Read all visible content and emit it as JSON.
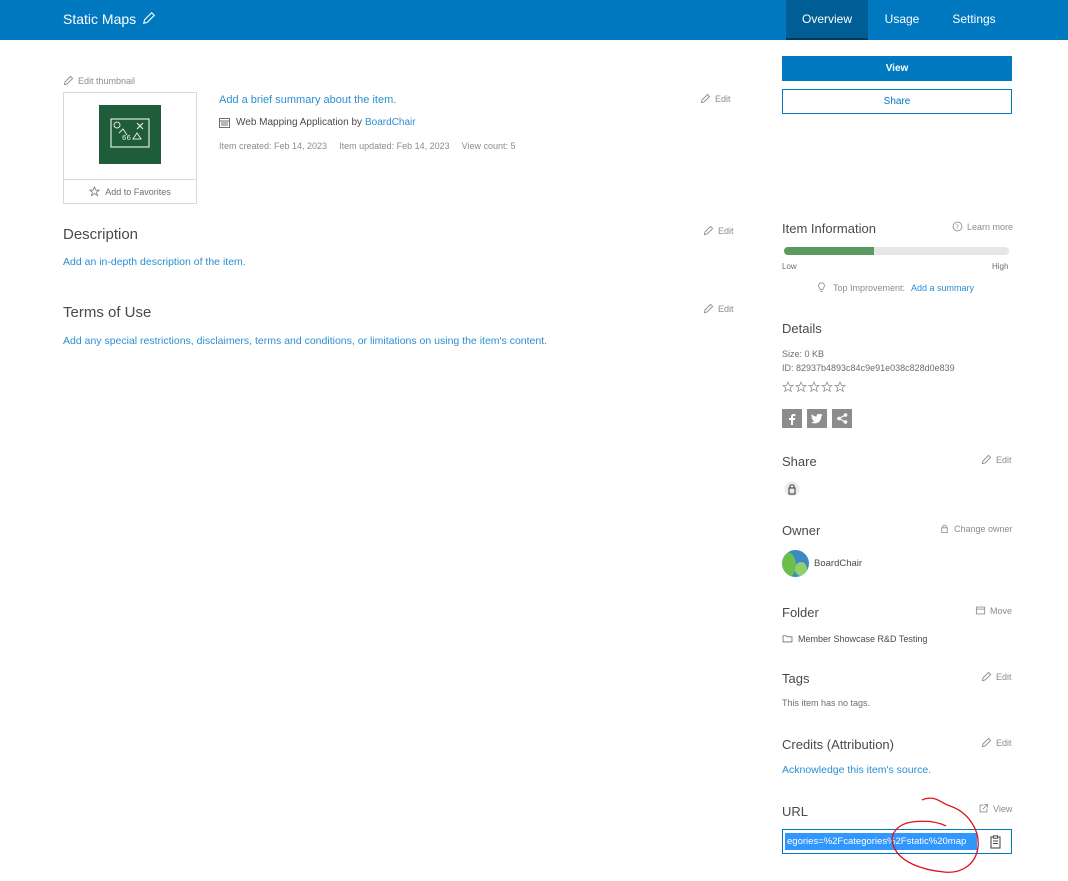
{
  "header": {
    "title": "Static Maps",
    "tabs": [
      {
        "label": "Overview",
        "active": true
      },
      {
        "label": "Usage",
        "active": false
      },
      {
        "label": "Settings",
        "active": false
      }
    ]
  },
  "item": {
    "edit_thumbnail": "Edit thumbnail",
    "add_favorites": "Add to Favorites",
    "summary_link": "Add a brief summary about the item.",
    "edit_label": "Edit",
    "type_prefix": "Web Mapping Application by",
    "owner_link": "BoardChair",
    "created": "Item created: Feb 14, 2023",
    "updated": "Item updated: Feb 14, 2023",
    "views": "View count: 5"
  },
  "description": {
    "title": "Description",
    "link": "Add an in-depth description of the item.",
    "edit_label": "Edit"
  },
  "terms": {
    "title": "Terms of Use",
    "link": "Add any special restrictions, disclaimers, terms and conditions, or limitations on using the item's content.",
    "edit_label": "Edit"
  },
  "actions": {
    "view_label": "View",
    "share_label": "Share"
  },
  "item_information": {
    "title": "Item Information",
    "learn_more": "Learn more",
    "progress_fraction": 0.4,
    "low_label": "Low",
    "high_label": "High",
    "top_improvement_label": "Top Improvement:",
    "top_improvement_link": "Add a summary",
    "progress_color": "#5a9a5e"
  },
  "details": {
    "title": "Details",
    "size": "Size: 0 KB",
    "id": "ID: 82937b4893c84c9e91e038c828d0e839",
    "rating_stars": 5
  },
  "share": {
    "title": "Share",
    "edit_label": "Edit"
  },
  "owner": {
    "title": "Owner",
    "change_label": "Change owner",
    "name": "BoardChair"
  },
  "folder": {
    "title": "Folder",
    "move_label": "Move",
    "name": "Member Showcase R&D Testing"
  },
  "tags": {
    "title": "Tags",
    "edit_label": "Edit",
    "text": "This item has no tags."
  },
  "credits": {
    "title": "Credits (Attribution)",
    "edit_label": "Edit",
    "link": "Acknowledge this item's source."
  },
  "url": {
    "title": "URL",
    "view_label": "View",
    "value": "egories=%2Fcategories%2Fstatic%20map"
  },
  "colors": {
    "brand": "#0079c1",
    "link": "#2b8fd4",
    "annotation": "#e0101a"
  }
}
